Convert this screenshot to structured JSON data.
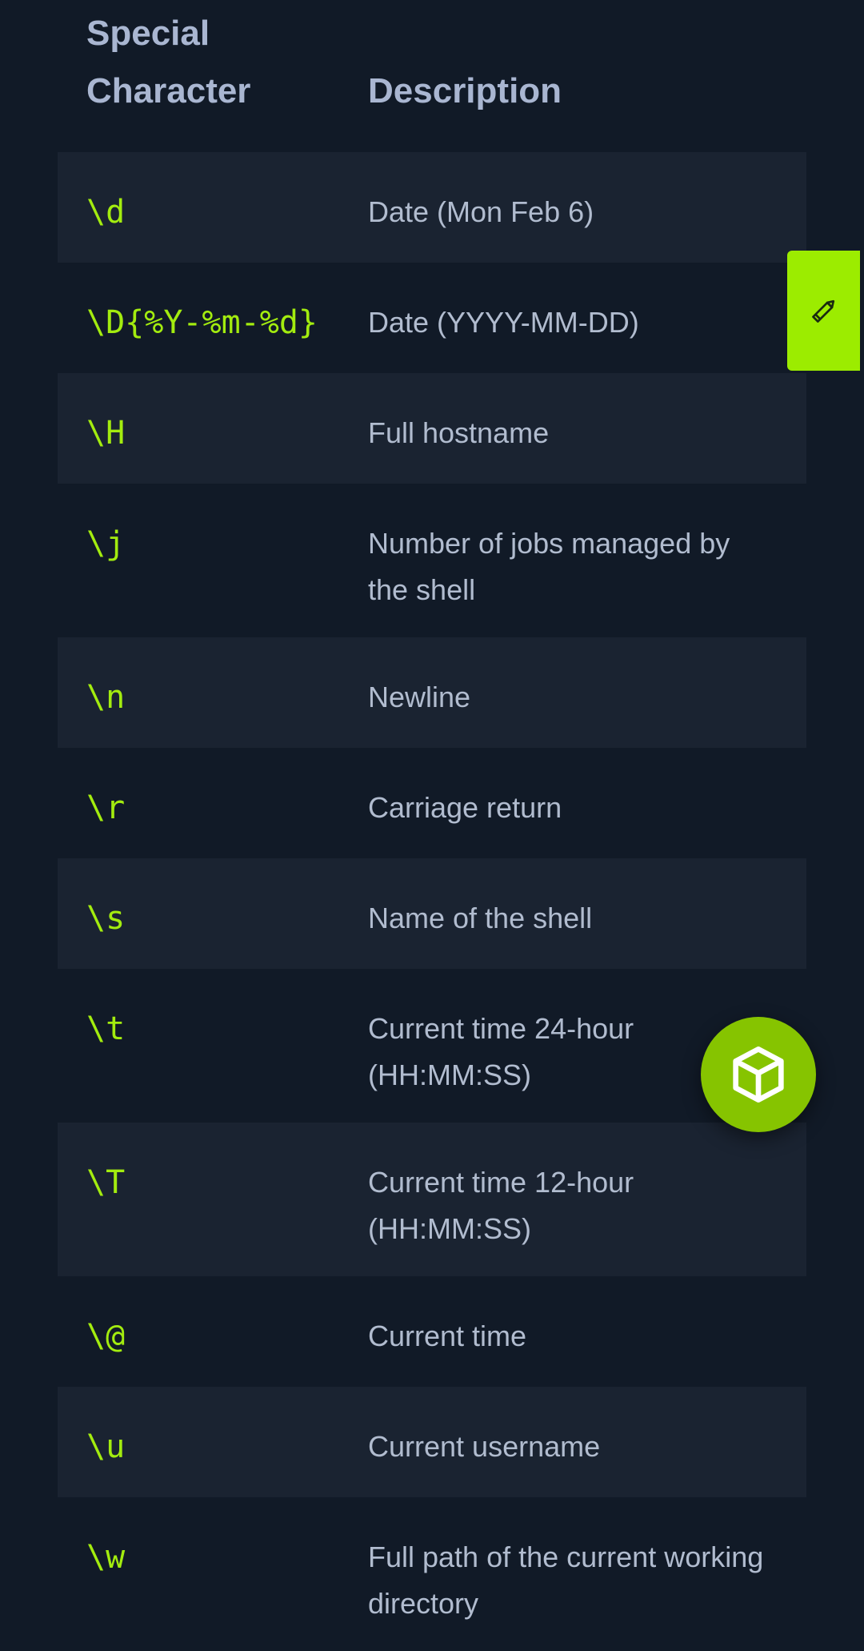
{
  "table": {
    "headers": {
      "col1_line1": "Special",
      "col1_line2": "Character",
      "col2": "Description"
    },
    "rows": [
      {
        "code": "\\d",
        "desc": "Date (Mon Feb 6)"
      },
      {
        "code": "\\D{%Y-%m-%d}",
        "desc": "Date (YYYY-MM-DD)"
      },
      {
        "code": "\\H",
        "desc": "Full hostname"
      },
      {
        "code": "\\j",
        "desc": "Number of jobs managed by the shell"
      },
      {
        "code": "\\n",
        "desc": "Newline"
      },
      {
        "code": "\\r",
        "desc": "Carriage return"
      },
      {
        "code": "\\s",
        "desc": "Name of the shell"
      },
      {
        "code": "\\t",
        "desc": "Current time 24-hour (HH:MM:SS)"
      },
      {
        "code": "\\T",
        "desc": "Current time 12-hour (HH:MM:SS)"
      },
      {
        "code": "\\@",
        "desc": "Current time"
      },
      {
        "code": "\\u",
        "desc": "Current username"
      },
      {
        "code": "\\w",
        "desc": "Full path of the current working directory"
      }
    ]
  },
  "floating": {
    "edit_icon": "pencil-icon",
    "fab_icon": "cube-icon"
  },
  "colors": {
    "background": "#111a27",
    "row_alt": "#1a2331",
    "code_text": "#a3ec0f",
    "desc_text": "#b1bccf",
    "header_text": "#a9b6d1",
    "edit_tab": "#9cec00",
    "fab": "#86c400"
  }
}
